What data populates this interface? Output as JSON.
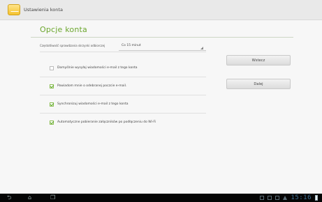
{
  "actionbar": {
    "title": "Ustawienia konta"
  },
  "section": {
    "title": "Opcje konta"
  },
  "frequency": {
    "label": "Częstotliwość sprawdzania skrzynki odbiorczej",
    "value": "Co 15 minut"
  },
  "options": [
    {
      "label": "Domyślnie wysyłaj wiadomości e-mail z tego konta",
      "checked": false
    },
    {
      "label": "Powiadom mnie o odebranej poczcie e-mail.",
      "checked": true
    },
    {
      "label": "Synchronizuj wiadomości e-mail z tego konta",
      "checked": true
    },
    {
      "label": "Automatyczne pobieranie załączników po podłączeniu do Wi-Fi",
      "checked": true
    }
  ],
  "buttons": {
    "back": "Wstecz",
    "next": "Dalej"
  },
  "statusbar": {
    "clock": "15:16"
  },
  "icons": {
    "nav_back": "back-arrow-icon",
    "nav_home": "home-icon",
    "nav_recent": "recent-apps-icon"
  }
}
